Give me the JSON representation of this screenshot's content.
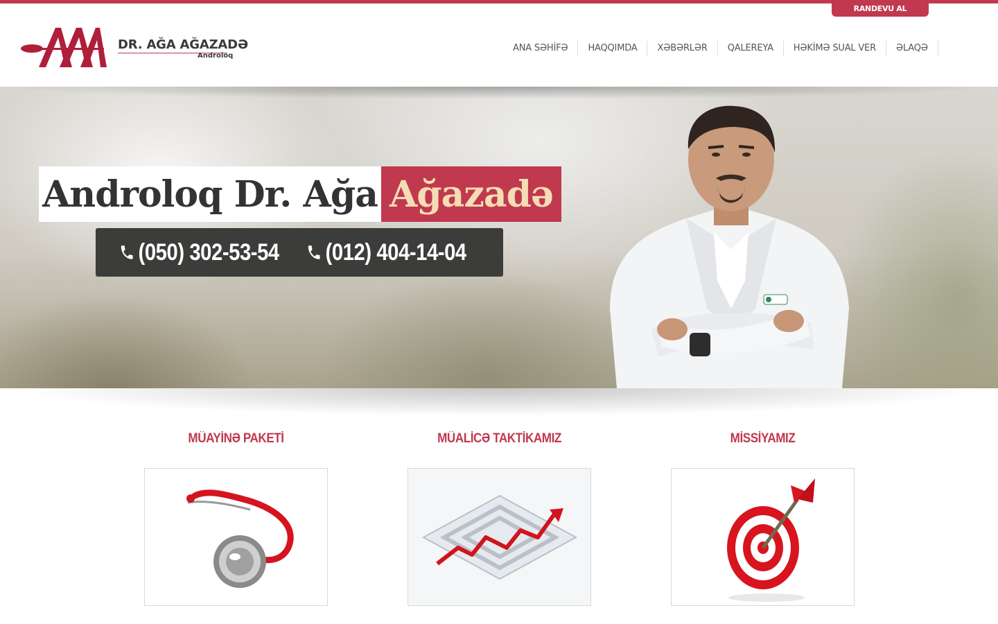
{
  "header": {
    "appointment_label": "RANDEVU AL",
    "logo": {
      "name": "DR. AĞA AĞAZADƏ",
      "subtitle": "Androloq"
    },
    "nav": [
      {
        "label": "ANA SƏHİFƏ"
      },
      {
        "label": "HAQQIMDA"
      },
      {
        "label": "XƏBƏRLƏR"
      },
      {
        "label": "QALEREYA"
      },
      {
        "label": "HƏKİMƏ SUAL VER"
      },
      {
        "label": "ƏLAQƏ"
      }
    ]
  },
  "hero": {
    "title_main": "Androloq Dr. Ağa",
    "title_accent": "Ağazadə",
    "phones": [
      "(050) 302-53-54",
      "(012) 404-14-04"
    ]
  },
  "features": [
    {
      "title": "MÜAYİNƏ PAKETİ",
      "icon": "stethoscope-icon"
    },
    {
      "title": "MÜALİCƏ TAKTİKAMIZ",
      "icon": "maze-icon"
    },
    {
      "title": "MİSSİYAMIZ",
      "icon": "target-icon"
    }
  ],
  "colors": {
    "brand": "#c0394e",
    "accent_text": "#f5dcb4",
    "phone_box": "#3c3c3a"
  }
}
